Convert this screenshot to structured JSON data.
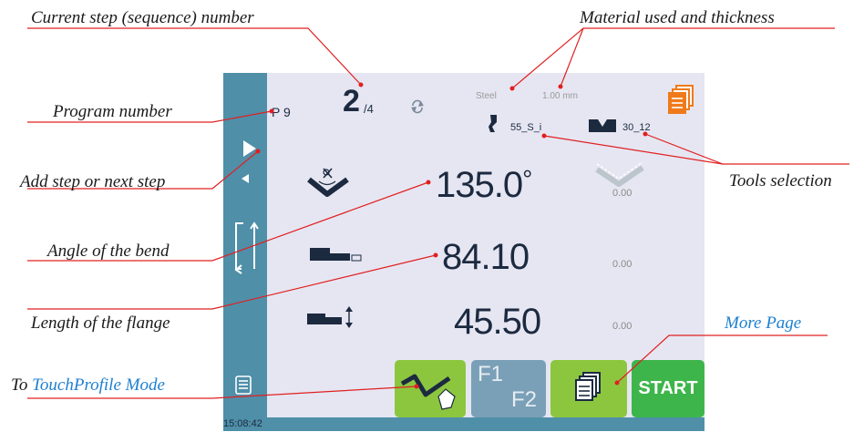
{
  "callouts": {
    "current_step": "Current step (sequence) number",
    "material": "Material used and thickness",
    "program_number": "Program number",
    "add_step": "Add step or next step",
    "tools_selection": "Tools selection",
    "angle_bend": "Angle of the bend",
    "flange_length": "Length of the flange",
    "more_page": "More Page",
    "touchprofile_prefix": "To ",
    "touchprofile_link": "TouchProfile Mode"
  },
  "header": {
    "program": "P 9",
    "step_current": "2",
    "step_total": "/4",
    "material": "Steel",
    "thickness": "1.00 mm",
    "punch_tool": "55_S_i",
    "die_tool": "30_12"
  },
  "values": {
    "angle": "135.0",
    "angle_unit": "°",
    "angle_correction": "0.00",
    "length": "84.10",
    "length_correction": "0.00",
    "height": "45.50",
    "height_correction": "0.00"
  },
  "buttons": {
    "f1": "F1",
    "f2": "F2",
    "start": "START"
  },
  "status": {
    "time": "15:08:42"
  },
  "colors": {
    "sidebar": "#4f8fa8",
    "screen_bg": "#e6e6f2",
    "green_button": "#8cc63f",
    "start_button": "#3db54a",
    "f_button": "#7aa0b8",
    "callout_line": "#e02020",
    "icon_orange": "#f07a1a"
  }
}
